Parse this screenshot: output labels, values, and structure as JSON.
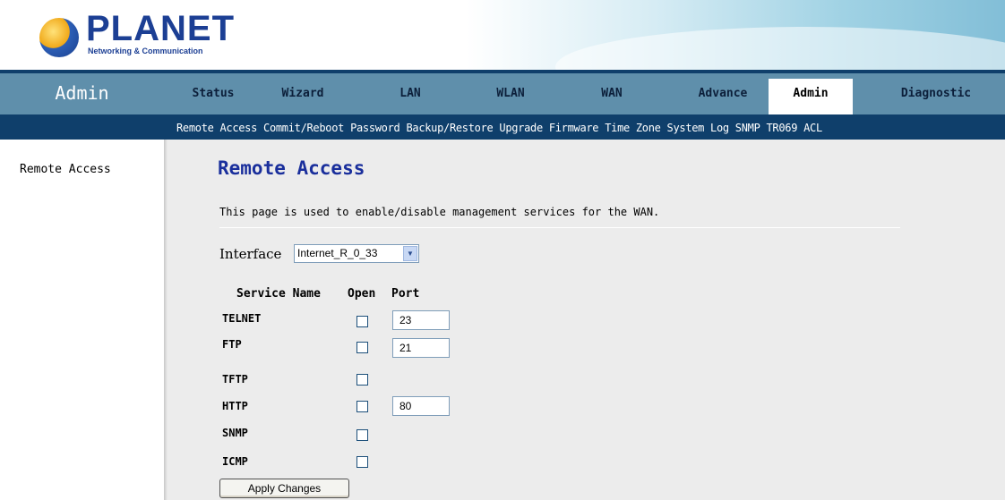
{
  "brand": {
    "name": "PLANET",
    "tagline": "Networking & Communication"
  },
  "section_title": "Admin",
  "main_tabs": [
    {
      "label": "Status",
      "active": false
    },
    {
      "label": "Wizard",
      "active": false
    },
    {
      "label": "LAN",
      "active": false
    },
    {
      "label": "WLAN",
      "active": false
    },
    {
      "label": "WAN",
      "active": false
    },
    {
      "label": "Advance",
      "active": false
    },
    {
      "label": "Admin",
      "active": true
    },
    {
      "label": "Diagnostic",
      "active": false
    }
  ],
  "sub_nav": [
    "Remote Access",
    "Commit/Reboot",
    "Password",
    "Backup/Restore",
    "Upgrade Firmware",
    "Time Zone",
    "System Log",
    "SNMP",
    "TR069",
    "ACL"
  ],
  "sidebar": {
    "items": [
      "Remote Access"
    ]
  },
  "page": {
    "title": "Remote Access",
    "description": "This page is used to enable/disable management services for the WAN.",
    "interface_label": "Interface",
    "interface_value": "Internet_R_0_33",
    "headers": {
      "service": "Service Name",
      "open": "Open",
      "port": "Port"
    },
    "services": [
      {
        "name": "TELNET",
        "open": false,
        "port": "23"
      },
      {
        "name": "FTP",
        "open": false,
        "port": "21"
      },
      {
        "name": "TFTP",
        "open": false,
        "port": null
      },
      {
        "name": "HTTP",
        "open": false,
        "port": "80"
      },
      {
        "name": "SNMP",
        "open": false,
        "port": null
      },
      {
        "name": "ICMP",
        "open": false,
        "port": null
      }
    ],
    "apply_label": "Apply Changes"
  },
  "colors": {
    "nav_bg": "#5f8fab",
    "subnav_bg": "#0f3f6b",
    "title_blue": "#1a2f9c",
    "content_bg": "#ececec"
  }
}
